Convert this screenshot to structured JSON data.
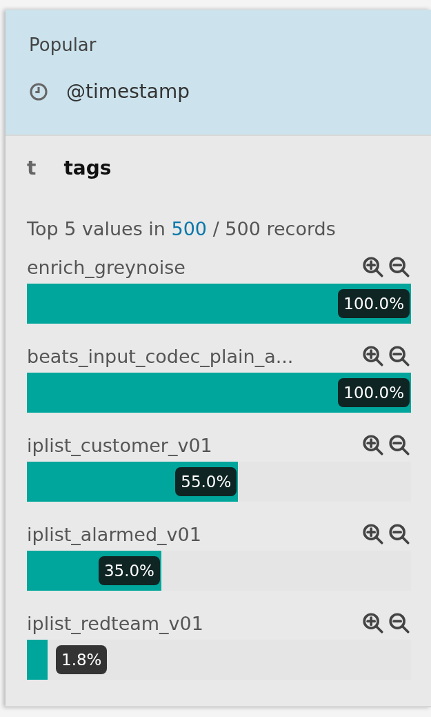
{
  "popular": {
    "title": "Popular",
    "fields": [
      {
        "name": "@timestamp"
      }
    ]
  },
  "field": {
    "type_glyph": "t",
    "name": "tags",
    "summary": {
      "prefix": "Top 5 values in",
      "link": "500",
      "suffix": "/ 500 records"
    },
    "values": [
      {
        "label": "enrich_greynoise",
        "level": 1.0,
        "percent": "100.0%"
      },
      {
        "label": "beats_input_codec_plain_a...",
        "level": 1.0,
        "percent": "100.0%"
      },
      {
        "label": "iplist_customer_v01",
        "level": 0.55,
        "percent": "55.0%"
      },
      {
        "label": "iplist_alarmed_v01",
        "level": 0.35,
        "percent": "35.0%"
      },
      {
        "label": "iplist_redteam_v01",
        "level": 0.018,
        "percent": "1.8%"
      }
    ]
  }
}
